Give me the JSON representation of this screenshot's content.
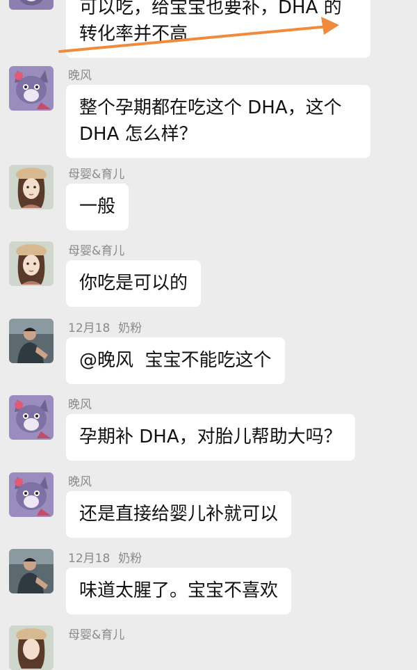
{
  "messages": [
    {
      "id": "m0",
      "avatar": "cat-cartoon-avatar",
      "lines": [
        "可以吃，给宝宝也要补，DHA 的",
        "转化率并不高"
      ]
    },
    {
      "id": "m1",
      "sender": "晚风",
      "avatar": "cat-cartoon-avatar",
      "lines": [
        "整个孕期都在吃这个 DHA，这个",
        "DHA 怎么样？"
      ]
    },
    {
      "id": "m2",
      "sender": "母婴&育儿",
      "avatar": "girl-illustration-avatar",
      "lines": [
        "一般"
      ]
    },
    {
      "id": "m3",
      "sender": "母婴&育儿",
      "avatar": "girl-illustration-avatar",
      "lines": [
        "你吃是可以的"
      ]
    },
    {
      "id": "m4",
      "date": "12月18",
      "sender": "奶粉",
      "avatar": "man-photo-avatar",
      "lines": [
        "@晚风  宝宝不能吃这个"
      ]
    },
    {
      "id": "m5",
      "sender": "晚风",
      "avatar": "cat-cartoon-avatar",
      "lines": [
        "孕期补 DHA，对胎儿帮助大吗？"
      ]
    },
    {
      "id": "m6",
      "sender": "晚风",
      "avatar": "cat-cartoon-avatar",
      "lines": [
        "还是直接给婴儿补就可以"
      ]
    },
    {
      "id": "m7",
      "date": "12月18",
      "sender": "奶粉",
      "avatar": "man-photo-avatar",
      "lines": [
        "味道太腥了。宝宝不喜欢"
      ]
    },
    {
      "id": "m8",
      "sender": "母婴&育儿",
      "avatar": "girl-illustration-avatar",
      "lines": []
    }
  ],
  "annotation": {
    "type": "arrow",
    "color": "#f08a3c",
    "icon": "orange-arrow-annotation-icon"
  },
  "colors": {
    "background": "#ececec",
    "bubble": "#ffffff",
    "sender_text": "#8a8a8a"
  }
}
